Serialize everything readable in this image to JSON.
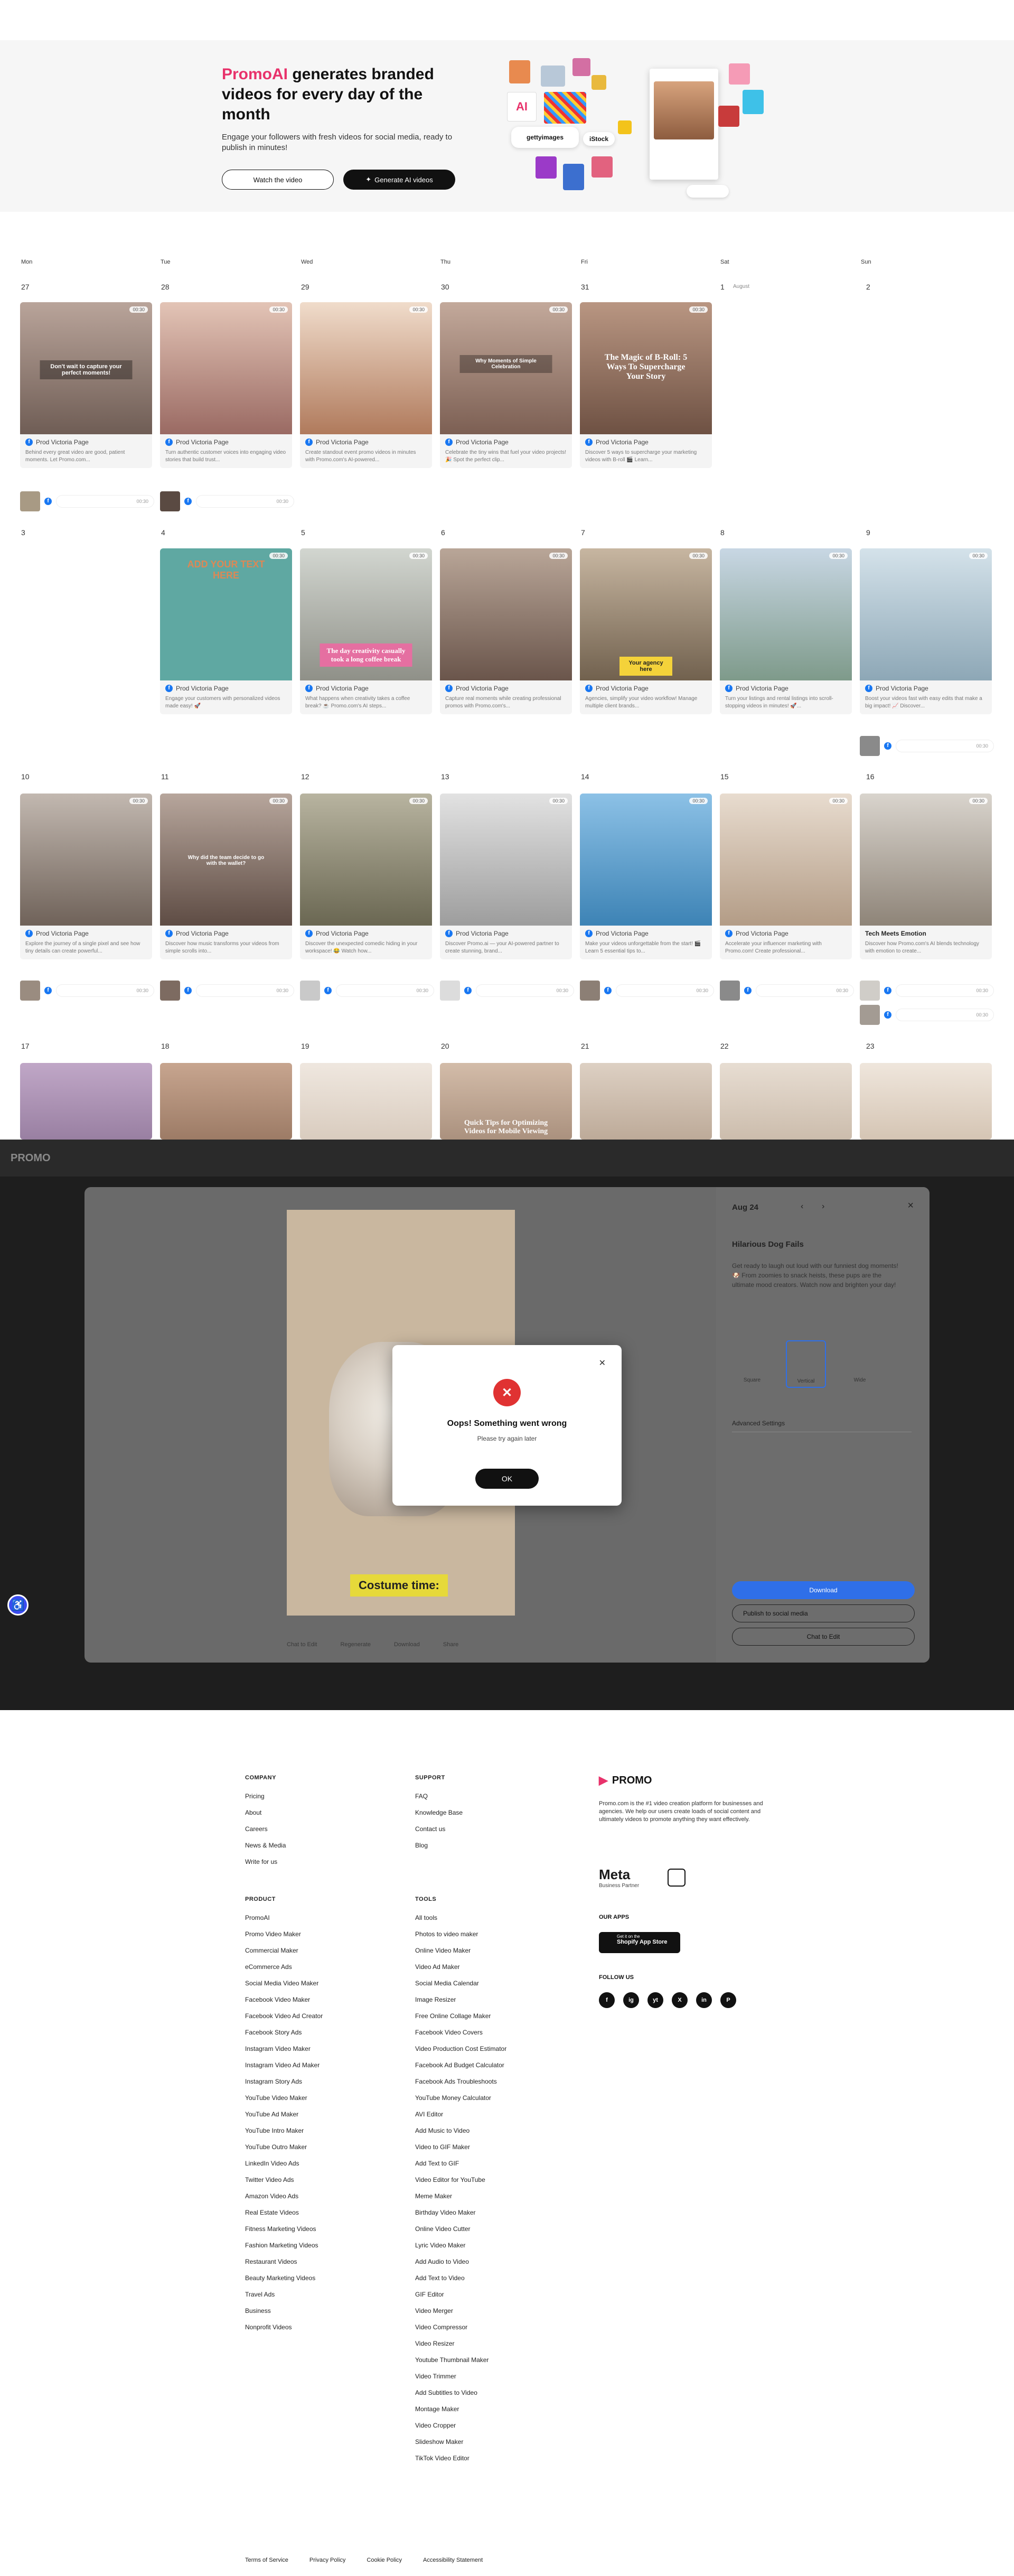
{
  "hero": {
    "brand": "PromoAI",
    "title_rest": " generates branded videos for every day of the month",
    "subtitle": "Engage your followers with fresh videos for social media, ready to publish in minutes!",
    "watch_label": "Watch the video",
    "generate_label": "Generate AI videos",
    "collage_badge_1": "gettyimages",
    "collage_badge_2": "iStock",
    "collage_ai": "AI"
  },
  "calendar": {
    "days_of_week": [
      "Mon",
      "Tue",
      "Wed",
      "Thu",
      "Fri",
      "Sat",
      "Sun"
    ],
    "page_name": "Prod Victoria Page",
    "week1_numbers": [
      "27",
      "28",
      "29",
      "30",
      "31",
      "1",
      "2"
    ],
    "week2_numbers": [
      "3",
      "4",
      "5",
      "6",
      "7",
      "8",
      "9"
    ],
    "week3_numbers": [
      "10",
      "11",
      "12",
      "13",
      "14",
      "15",
      "16"
    ],
    "week4_numbers": [
      "17",
      "18",
      "19",
      "20",
      "21",
      "22",
      "23"
    ],
    "month_label": "August",
    "cards_week1": [
      {
        "caption": "Don't wait to capture your perfect moments!",
        "desc": "Behind every great video are good, patient moments. Let Promo.com..."
      },
      {
        "caption": "",
        "desc": "Turn authentic customer voices into engaging video stories that build trust..."
      },
      {
        "caption": "",
        "desc": "Create standout event promo videos in minutes with Promo.com's AI-powered..."
      },
      {
        "caption": "Why Moments of Simple Celebration",
        "desc": "Celebrate the tiny wins that fuel your video projects! 🎉 Spot the perfect clip..."
      },
      {
        "caption": "The Magic of B-Roll: 5 Ways To Supercharge Your Story",
        "desc": "Discover 5 ways to supercharge your marketing videos with B-roll 🎬 Learn..."
      }
    ],
    "cards_week2": [
      {
        "caption": "ADD YOUR TEXT HERE",
        "desc": "Engage your customers with personalized videos made easy! 🚀"
      },
      {
        "caption": "The day creativity casually took a long coffee break",
        "desc": "What happens when creativity takes a coffee break? ☕ Promo.com's AI steps..."
      },
      {
        "caption": "",
        "desc": "Capture real moments while creating professional promos with Promo.com's..."
      },
      {
        "caption": "Your agency here",
        "desc": "Agencies, simplify your video workflow! Manage multiple client brands..."
      },
      {
        "caption": "",
        "desc": "Turn your listings and rental listings into scroll-stopping videos in minutes! 🚀..."
      },
      {
        "caption": "",
        "desc": "Boost your videos fast with easy edits that make a big impact! 📈 Discover..."
      }
    ],
    "cards_week3": [
      {
        "caption": "",
        "desc": "Explore the journey of a single pixel and see how tiny details can create powerful..."
      },
      {
        "caption": "Why did the team decide to go with the wallet?",
        "desc": "Discover how music transforms your videos from simple scrolls into..."
      },
      {
        "caption": "",
        "desc": "Discover the unexpected comedic hiding in your workspace! 😂 Watch how..."
      },
      {
        "caption": "",
        "desc": "Discover Promo.ai — your AI-powered partner to create stunning, brand..."
      },
      {
        "caption": "",
        "desc": "Make your videos unforgettable from the start! 🎬 Learn 5 essential tips to..."
      },
      {
        "caption": "",
        "desc": "Accelerate your influencer marketing with Promo.com! Create professional..."
      },
      {
        "caption": "Tech Meets Emotion",
        "desc": "Discover how Promo.com's AI blends technology with emotion to create..."
      }
    ],
    "cards_week4": [
      {
        "caption": ""
      },
      {
        "caption": ""
      },
      {
        "caption": ""
      },
      {
        "caption": "Quick Tips for Optimizing Videos for Mobile Viewing"
      },
      {
        "caption": ""
      },
      {
        "caption": ""
      },
      {
        "caption": ""
      }
    ]
  },
  "modal": {
    "date": "Aug 24",
    "video_title": "Hilarious Dog Fails",
    "video_desc": "Get ready to laugh out loud with our funniest dog moments! 🐶 From zoomies to snack heists, these pups are the ultimate mood creators. Watch now and brighten your day!",
    "formats": [
      "Square",
      "Vertical",
      "Wide"
    ],
    "advanced": "Advanced Settings",
    "video_caption": "Costume time:",
    "download": "Download",
    "publish": "Publish to social media",
    "chat": "Chat to Edit",
    "actions": [
      "Chat to Edit",
      "Regenerate",
      "Download",
      "Share"
    ]
  },
  "dialog": {
    "title": "Oops! Something went wrong",
    "subtitle": "Please try again later",
    "ok": "OK"
  },
  "footer": {
    "company_title": "COMPANY",
    "company": [
      "Pricing",
      "About",
      "Careers",
      "News & Media",
      "Write for us"
    ],
    "support_title": "SUPPORT",
    "support": [
      "FAQ",
      "Knowledge Base",
      "Contact us",
      "Blog"
    ],
    "product_title": "PRODUCT",
    "product": [
      "PromoAI",
      "Promo Video Maker",
      "Commercial Maker",
      "eCommerce Ads",
      "Social Media Video Maker",
      "Facebook Video Maker",
      "Facebook Video Ad Creator",
      "Facebook Story Ads",
      "Instagram Video Maker",
      "Instagram Video Ad Maker",
      "Instagram Story Ads",
      "YouTube Video Maker",
      "YouTube Ad Maker",
      "YouTube Intro Maker",
      "YouTube Outro Maker",
      "LinkedIn Video Ads",
      "Twitter Video Ads",
      "Amazon Video Ads",
      "Real Estate Videos",
      "Fitness Marketing Videos",
      "Fashion Marketing Videos",
      "Restaurant Videos",
      "Beauty Marketing Videos",
      "Travel Ads",
      "Business",
      "Nonprofit Videos"
    ],
    "tools_title": "TOOLS",
    "tools": [
      "All tools",
      "Photos to video maker",
      "Online Video Maker",
      "Video Ad Maker",
      "Social Media Calendar",
      "Image Resizer",
      "Free Online Collage Maker",
      "Facebook Video Covers",
      "Video Production Cost Estimator",
      "Facebook Ad Budget Calculator",
      "Facebook Ads Troubleshoots",
      "YouTube Money Calculator",
      "AVI Editor",
      "Add Music to Video",
      "Video to GIF Maker",
      "Add Text to GIF",
      "Video Editor for YouTube",
      "Meme Maker",
      "Birthday Video Maker",
      "Online Video Cutter",
      "Lyric Video Maker",
      "Add Audio to Video",
      "Add Text to Video",
      "GIF Editor",
      "Video Merger",
      "Video Compressor",
      "Video Resizer",
      "Youtube Thumbnail Maker",
      "Video Trimmer",
      "Add Subtitles to Video",
      "Montage Maker",
      "Video Cropper",
      "Slideshow Maker",
      "TikTok Video Editor"
    ],
    "logo": "PROMO",
    "about": "Promo.com is the #1 video creation platform for businesses and agencies. We help our users create loads of social content and ultimately videos to promote anything they want effectively.",
    "meta": "Meta",
    "meta_sub": "Business Partner",
    "apps_title": "OUR APPS",
    "shopify_small": "Get it on the",
    "shopify": "Shopify App Store",
    "follow_title": "FOLLOW US",
    "social": [
      "f",
      "ig",
      "yt",
      "X",
      "in",
      "P"
    ],
    "bottom": [
      "Terms of Service",
      "Privacy Policy",
      "Cookie Policy",
      "Accessibility Statement"
    ]
  },
  "colors": {
    "brand": "#e8326b",
    "fb": "#1877f2",
    "download": "#2f6fe8",
    "error": "#e03232"
  }
}
